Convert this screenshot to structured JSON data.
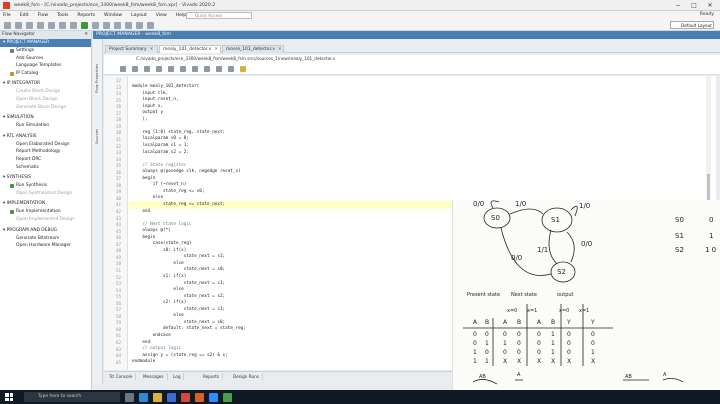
{
  "window": {
    "title": "week8_fsm - [C:/vivado_projects/ece_3300/week8_fsm/week8_fsm.xpr] - Vivado 2020.2",
    "min": "−",
    "max": "□",
    "close": "✕"
  },
  "menu": [
    "File",
    "Edit",
    "Flow",
    "Tools",
    "Reports",
    "Window",
    "Layout",
    "View",
    "Help"
  ],
  "quick_access_placeholder": "Quick Access",
  "status_ready": "Ready",
  "layout_select": "Default Layout",
  "flow_navigator": {
    "title": "Flow Navigator",
    "sections": [
      {
        "label": "PROJECT MANAGER",
        "items": [
          {
            "label": "Settings",
            "disabled": false,
            "icon_color": "#7a7a7a"
          },
          {
            "label": "Add Sources",
            "disabled": false,
            "icon_color": ""
          },
          {
            "label": "Language Templates",
            "disabled": false,
            "icon_color": ""
          },
          {
            "label": "IP Catalog",
            "disabled": false,
            "icon_color": "#d08a2a"
          }
        ]
      },
      {
        "label": "IP INTEGRATOR",
        "items": [
          {
            "label": "Create Block Design",
            "disabled": true
          },
          {
            "label": "Open Block Design",
            "disabled": true
          },
          {
            "label": "Generate Block Design",
            "disabled": true
          }
        ]
      },
      {
        "label": "SIMULATION",
        "items": [
          {
            "label": "Run Simulation",
            "disabled": false
          }
        ]
      },
      {
        "label": "RTL ANALYSIS",
        "items": [
          {
            "label": "Open Elaborated Design",
            "disabled": false
          },
          {
            "label": "Report Methodology",
            "disabled": false
          },
          {
            "label": "Report DRC",
            "disabled": false
          },
          {
            "label": "Schematic",
            "disabled": false
          }
        ]
      },
      {
        "label": "SYNTHESIS",
        "items": [
          {
            "label": "Run Synthesis",
            "disabled": false,
            "icon_color": "#3a9a3a"
          },
          {
            "label": "Open Synthesized Design",
            "disabled": true
          }
        ]
      },
      {
        "label": "IMPLEMENTATION",
        "items": [
          {
            "label": "Run Implementation",
            "disabled": false,
            "icon_color": "#3a9a3a"
          },
          {
            "label": "Open Implemented Design",
            "disabled": true
          }
        ]
      },
      {
        "label": "PROGRAM AND DEBUG",
        "items": [
          {
            "label": "Generate Bitstream",
            "disabled": false
          },
          {
            "label": "Open Hardware Manager",
            "disabled": false
          }
        ]
      }
    ]
  },
  "project_manager_bar": "PROJECT MANAGER - week8_fsm",
  "vertical_tabs": [
    "Flow Properties",
    "Sources"
  ],
  "editor_tabs": [
    {
      "label": "Project Summary",
      "active": false
    },
    {
      "label": "mealy_101_detector.v",
      "active": true
    },
    {
      "label": "moore_101_detector.v",
      "active": false
    }
  ],
  "file_path": "C:/vivado_projects/ece_3300/week8_fsm/week8_fsm.srcs/sources_1/new/mealy_101_detector.v",
  "code_lines": [
    {
      "n": "22",
      "t": ""
    },
    {
      "n": "23",
      "t": "module mealy_101_detector("
    },
    {
      "n": "24",
      "t": "    input clk,"
    },
    {
      "n": "25",
      "t": "    input reset_n,"
    },
    {
      "n": "26",
      "t": "    input x,"
    },
    {
      "n": "27",
      "t": "    output y"
    },
    {
      "n": "28",
      "t": "    );"
    },
    {
      "n": "29",
      "t": ""
    },
    {
      "n": "30",
      "t": "    reg [1:0] state_reg, state_next;"
    },
    {
      "n": "31",
      "t": "    localparam s0 = 0;"
    },
    {
      "n": "32",
      "t": "    localparam s1 = 1;"
    },
    {
      "n": "33",
      "t": "    localparam s2 = 2;"
    },
    {
      "n": "34",
      "t": ""
    },
    {
      "n": "35",
      "t": "    // State register",
      "c": true
    },
    {
      "n": "36",
      "t": "    always @(posedge clk, negedge reset_n)"
    },
    {
      "n": "37",
      "t": "    begin"
    },
    {
      "n": "38",
      "t": "        if (~reset_n)"
    },
    {
      "n": "39",
      "t": "            state_reg <= s0;"
    },
    {
      "n": "40",
      "t": "        else"
    },
    {
      "n": "41",
      "t": "            state_reg <= state_next;"
    },
    {
      "n": "42",
      "t": "    end"
    },
    {
      "n": "43",
      "t": ""
    },
    {
      "n": "44",
      "t": "    // Next state logic",
      "c": true
    },
    {
      "n": "45",
      "t": "    always @(*)"
    },
    {
      "n": "46",
      "t": "    begin"
    },
    {
      "n": "47",
      "t": "        case(state_reg)"
    },
    {
      "n": "48",
      "t": "            s0: if(x)"
    },
    {
      "n": "49",
      "t": "                    state_next = s1;"
    },
    {
      "n": "50",
      "t": "                else"
    },
    {
      "n": "51",
      "t": "                    state_next = s0;"
    },
    {
      "n": "52",
      "t": "            s1: if(x)"
    },
    {
      "n": "53",
      "t": "                    state_next = s1;"
    },
    {
      "n": "54",
      "t": "                else"
    },
    {
      "n": "55",
      "t": "                    state_next = s2;"
    },
    {
      "n": "56",
      "t": "            s2: if(x)"
    },
    {
      "n": "57",
      "t": "                    state_next = s1;"
    },
    {
      "n": "58",
      "t": "                else"
    },
    {
      "n": "59",
      "t": "                    state_next = s0;"
    },
    {
      "n": "60",
      "t": "            default: state_next = state_reg;"
    },
    {
      "n": "61",
      "t": "        endcase"
    },
    {
      "n": "62",
      "t": "    end"
    },
    {
      "n": "63",
      "t": "    // output logic",
      "c": true
    },
    {
      "n": "64",
      "t": "    assign y = (state_reg == s2) & x;"
    },
    {
      "n": "65",
      "t": "endmodule"
    }
  ],
  "console_tabs": [
    "Tcl Console",
    "Messages",
    "Log",
    "Reports",
    "Design Runs"
  ],
  "paper": {
    "states": [
      "S0",
      "S1",
      "S2"
    ],
    "edge_labels": [
      "1/0",
      "0/0",
      "1/0",
      "0/0",
      "1/1"
    ],
    "encoding": [
      {
        "s": "S0",
        "v": "0"
      },
      {
        "s": "S1",
        "v": "1"
      },
      {
        "s": "S2",
        "v": "1 0"
      }
    ],
    "headers": [
      "Present state",
      "Next state",
      "output"
    ],
    "sub_headers": [
      "x=0",
      "x=1",
      "x=0",
      "x=1"
    ],
    "cols": [
      "A",
      "B",
      "A",
      "B",
      "A",
      "B",
      "Y",
      "Y"
    ],
    "rows": [
      [
        "0",
        "0",
        "0",
        "0",
        "0",
        "1",
        "0",
        "0"
      ],
      [
        "0",
        "1",
        "1",
        "0",
        "0",
        "1",
        "0",
        "0"
      ],
      [
        "1",
        "0",
        "0",
        "0",
        "0",
        "1",
        "0",
        "1"
      ],
      [
        "1",
        "1",
        "X",
        "X",
        "X",
        "X",
        "X",
        "X"
      ]
    ],
    "bottom_labels": [
      "AB",
      "A",
      "AB",
      "A"
    ]
  },
  "taskbar": {
    "search_placeholder": "Type here to search"
  }
}
